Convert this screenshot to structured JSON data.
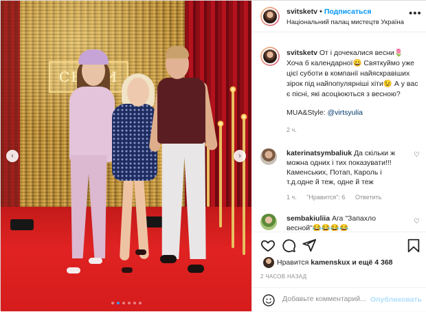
{
  "post": {
    "author": "svitsketv",
    "follow_label": "Подписаться",
    "separator": "•",
    "location": "Національний палац мистецтв Україна",
    "more_icon": "more-horizontal-icon"
  },
  "photo": {
    "sign_text": "СВ ЖИ",
    "nav_prev_icon": "chevron-left-icon",
    "nav_next_icon": "chevron-right-icon",
    "prev_glyph": "‹",
    "next_glyph": "›",
    "carousel": {
      "total": 6,
      "active": 2
    }
  },
  "caption": {
    "username": "svitsketv",
    "text": "От і дочекалися весни🌷 Хоча б календарної😀 Святкуймо уже цієї суботи в компанії найяскравіших зірок під найпопулярніші хіти😉 А у вас є пісні, які асоціюються з весною?",
    "credit_prefix": "MUA&Style: ",
    "credit_mention": "@virtsyulia",
    "time": "2 ч."
  },
  "comments": [
    {
      "username": "katerinatsymbaliuk",
      "text": "Да скільки ж можна одних і тих показувати!!! Каменських, Потап, Кароль і т.д.одне й теж, одне й теж",
      "time": "1 ч.",
      "likes": "\"Нравится\": 6",
      "reply": "Ответить"
    },
    {
      "username": "sembakiuliia",
      "text": "Ага \"Запахло весной\"😂😂😂😂",
      "time": "",
      "likes": "",
      "reply": ""
    }
  ],
  "actions": {
    "like_icon": "heart-icon",
    "comment_icon": "comment-icon",
    "share_icon": "share-icon",
    "save_icon": "bookmark-icon"
  },
  "likes": {
    "prefix": "Нравится",
    "user": "kamenskux",
    "suffix": "и ещё 4 368"
  },
  "posted_ago": "2 ЧАСОВ НАЗАД",
  "comment_box": {
    "emoji_icon": "emoji-icon",
    "placeholder": "Добавьте комментарий...",
    "publish_label": "Опубликовать"
  },
  "colors": {
    "link_blue": "#0095f6",
    "mention_blue": "#00376b",
    "muted_gray": "#8e8e8e",
    "carousel_active": "#3897f0"
  }
}
